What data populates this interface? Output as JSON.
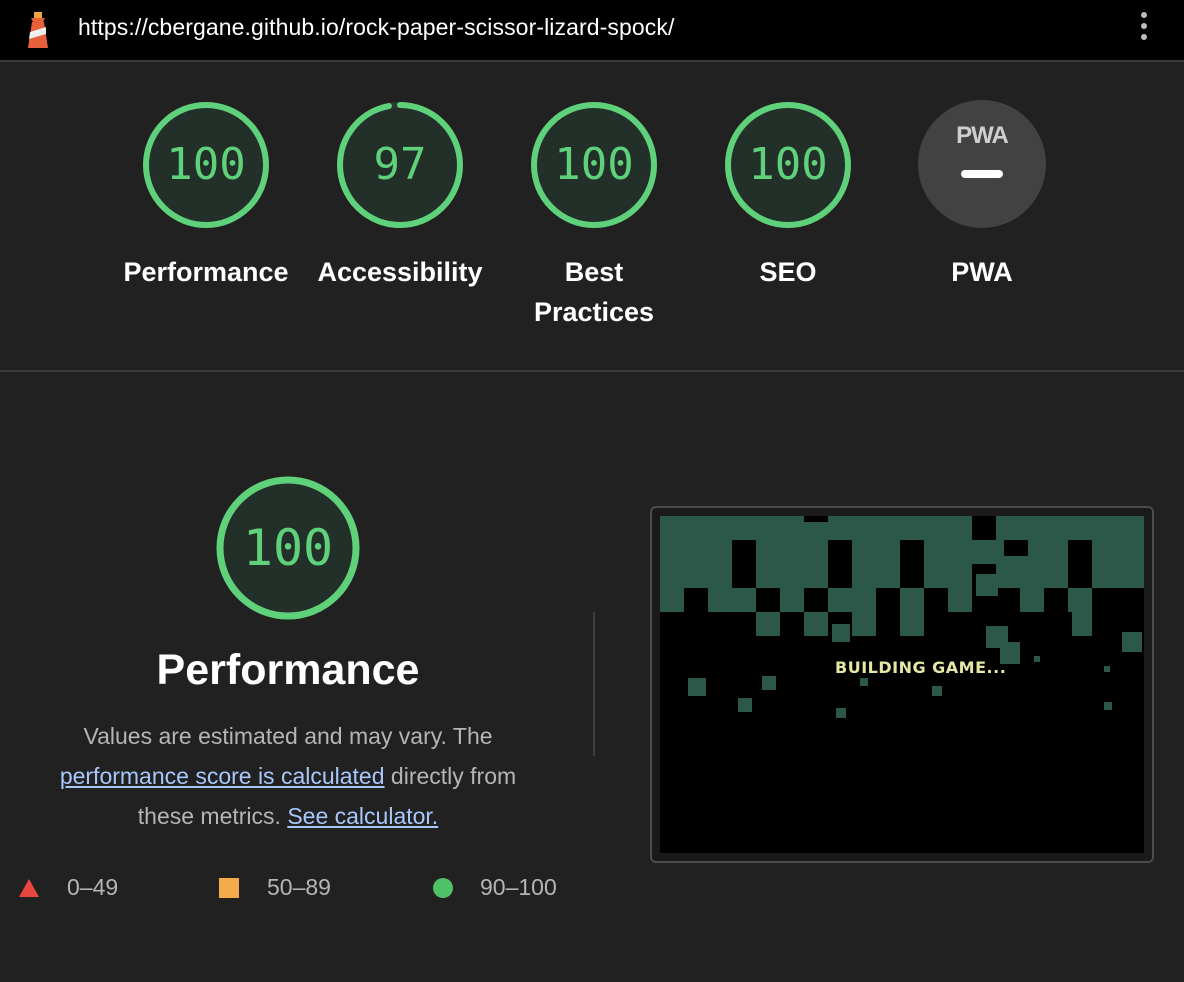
{
  "browser": {
    "url": "https://cbergane.github.io/rock-paper-scissor-lizard-spock/",
    "logo_icon": "lighthouse-icon",
    "menu_icon": "kebab-menu-icon"
  },
  "gauges": [
    {
      "label": "Performance",
      "score": "100",
      "score_value": 100
    },
    {
      "label": "Accessibility",
      "score": "97",
      "score_value": 97
    },
    {
      "label": "Best Practices",
      "score": "100",
      "score_value": 100
    },
    {
      "label": "SEO",
      "score": "100",
      "score_value": 100
    },
    {
      "label": "PWA",
      "badge": "PWA",
      "icon": "pwa-badge-icon"
    }
  ],
  "performance": {
    "score": "100",
    "score_value": 100,
    "title": "Performance",
    "desc_1": "Values are estimated and may vary. The",
    "link_1": "performance score is calculated",
    "desc_2": " directly from these metrics.",
    "link_2": "See calculator."
  },
  "legend": [
    {
      "range": "0–49",
      "icon": "triangle-icon",
      "color": "#e8473d"
    },
    {
      "range": "50–89",
      "icon": "square-icon",
      "color": "#f4ac4a"
    },
    {
      "range": "90–100",
      "icon": "circle-icon",
      "color": "#4fc269"
    }
  ],
  "screenshot": {
    "text": "BUILDING GAME..."
  },
  "colors": {
    "pass": "#5fd17a",
    "background": "#212121",
    "link": "#a8c7fa"
  }
}
